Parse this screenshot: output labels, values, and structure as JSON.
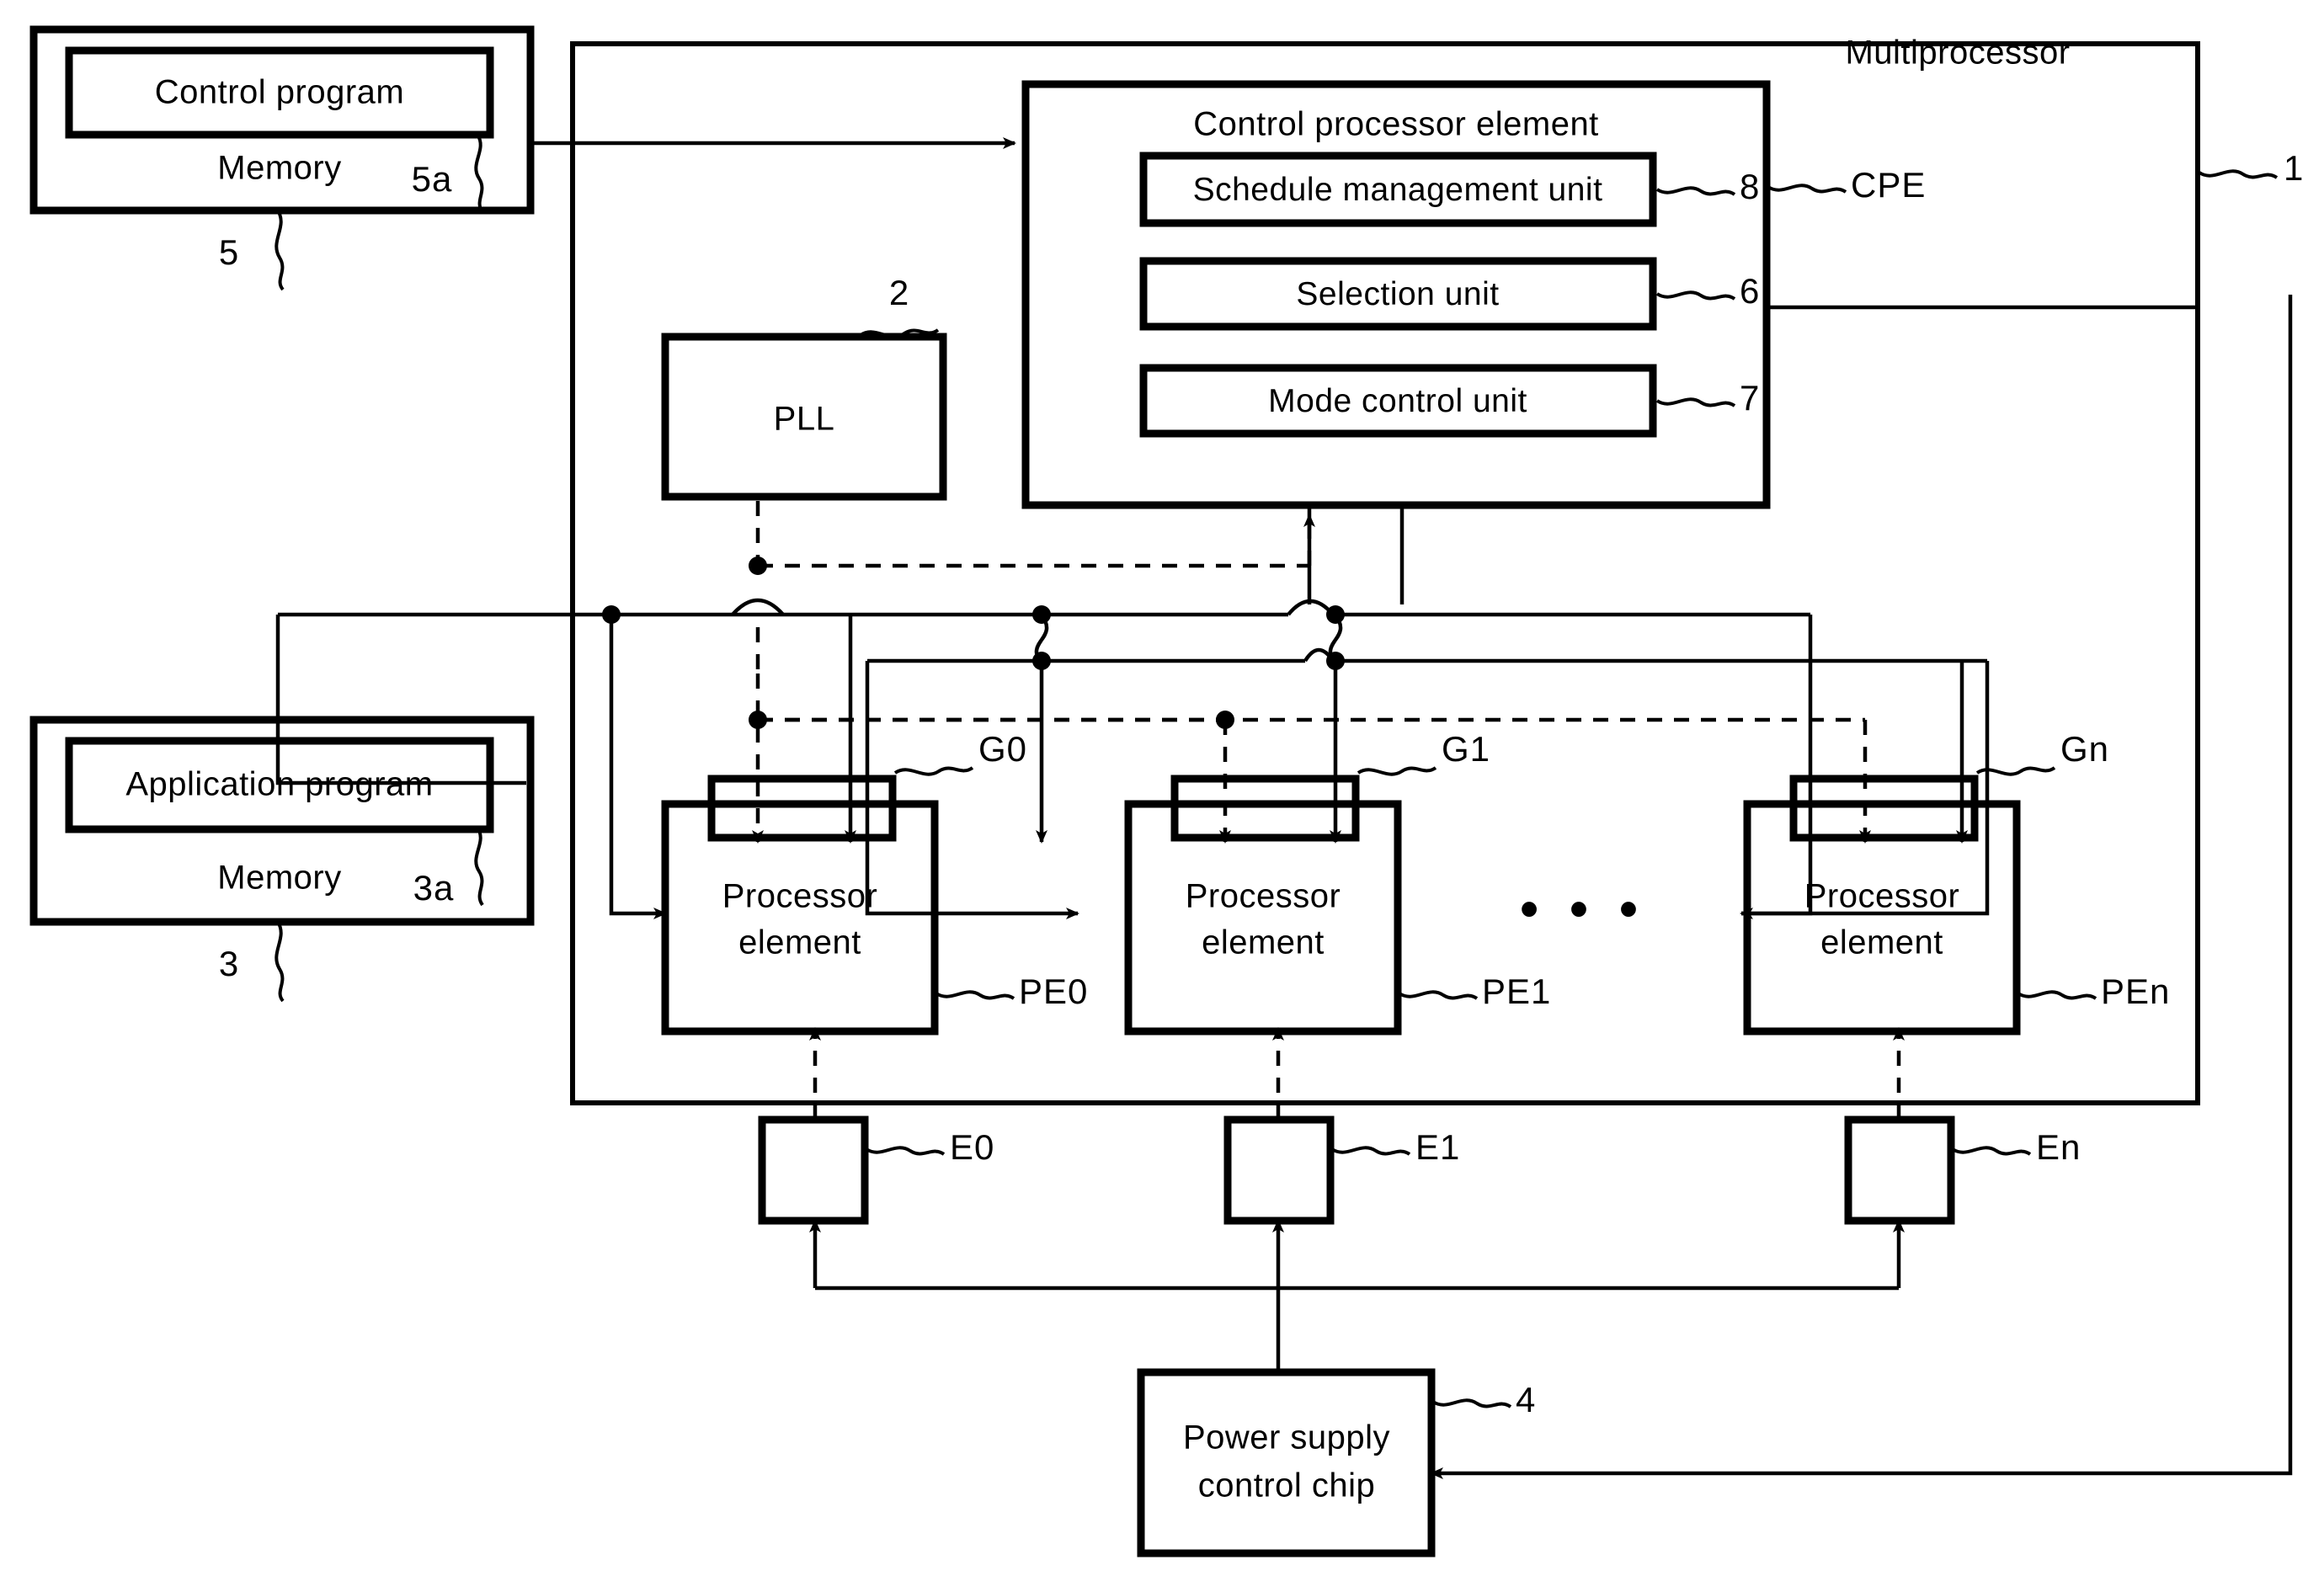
{
  "figure": {
    "type": "patent-block-diagram",
    "title_label": "Multiprocessor",
    "title_ref": "1"
  },
  "blocks": {
    "control_memory": {
      "inner_label": "Control program",
      "outer_label": "Memory",
      "inner_ref": "5a",
      "outer_ref": "5"
    },
    "application_memory": {
      "inner_label": "Application program",
      "outer_label": "Memory",
      "inner_ref": "3a",
      "outer_ref": "3"
    },
    "pll": {
      "label": "PLL",
      "ref": "2"
    },
    "cpe": {
      "title": "Control processor element",
      "ref": "CPE",
      "units": [
        {
          "label": "Schedule management unit",
          "ref": "8"
        },
        {
          "label": "Selection unit",
          "ref": "6"
        },
        {
          "label": "Mode control unit",
          "ref": "7"
        }
      ]
    },
    "processor_elements": [
      {
        "label_line1": "Processor",
        "label_line2": "element",
        "gate_ref": "G0",
        "pe_ref": "PE0",
        "power_ref": "E0"
      },
      {
        "label_line1": "Processor",
        "label_line2": "element",
        "gate_ref": "G1",
        "pe_ref": "PE1",
        "power_ref": "E1"
      },
      {
        "label_line1": "Processor",
        "label_line2": "element",
        "gate_ref": "Gn",
        "pe_ref": "PEn",
        "power_ref": "En"
      }
    ],
    "ellipsis": "• • •",
    "power_supply": {
      "label_line1": "Power supply",
      "label_line2": "control chip",
      "ref": "4"
    }
  },
  "colors": {
    "stroke": "#000000",
    "background": "#ffffff"
  }
}
